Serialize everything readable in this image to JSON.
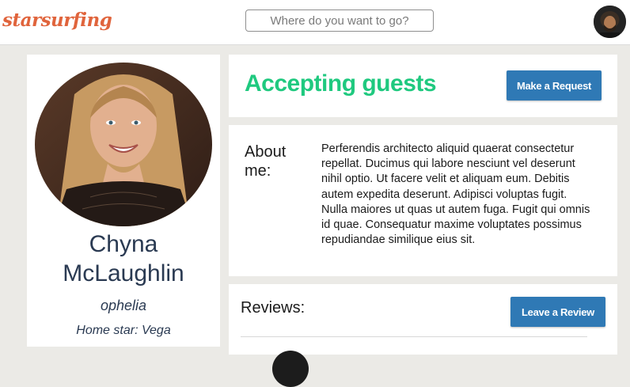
{
  "header": {
    "logo": "starsurfing",
    "search_placeholder": "Where do you want to go?"
  },
  "profile": {
    "name": "Chyna McLaughlin",
    "username": "ophelia",
    "home_star": "Home star: Vega"
  },
  "status": {
    "text": "Accepting guests",
    "request_button": "Make a Request"
  },
  "about": {
    "label": "About me:",
    "text": "Perferendis architecto aliquid quaerat consectetur repellat. Ducimus qui labore nesciunt vel deserunt nihil optio. Ut facere velit et aliquam eum. Debitis autem expedita deserunt. Adipisci voluptas fugit. Nulla maiores ut quas ut autem fuga. Fugit qui omnis id quae. Consequatur maxime voluptates possimus repudiandae similique eius sit."
  },
  "reviews": {
    "title": "Reviews:",
    "leave_button": "Leave a Review"
  },
  "colors": {
    "logo": "#e0643c",
    "status_green": "#1fc97f",
    "button_blue": "#2f79b5",
    "name_navy": "#2a3a52",
    "page_background": "#ebeae6"
  }
}
